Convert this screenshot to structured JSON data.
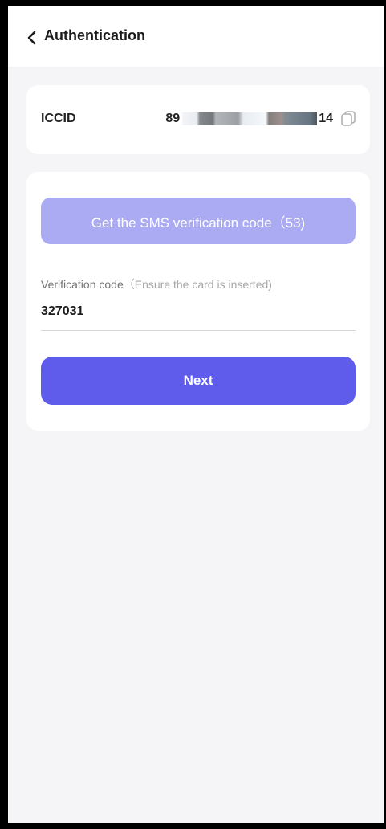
{
  "header": {
    "title": "Authentication",
    "back_icon": "chevron-left-icon"
  },
  "iccid": {
    "label": "ICCID",
    "value_prefix": "89",
    "value_suffix": "14",
    "copy_icon": "copy-icon"
  },
  "verify": {
    "sms_button_label": "Get the SMS verification code（53)",
    "field_label": "Verification code",
    "field_hint": "（Ensure the card is inserted)",
    "code_value": "327031",
    "next_label": "Next"
  },
  "colors": {
    "primary": "#5f5cec",
    "primary_disabled": "#ababf4",
    "background": "#f5f5f7"
  }
}
